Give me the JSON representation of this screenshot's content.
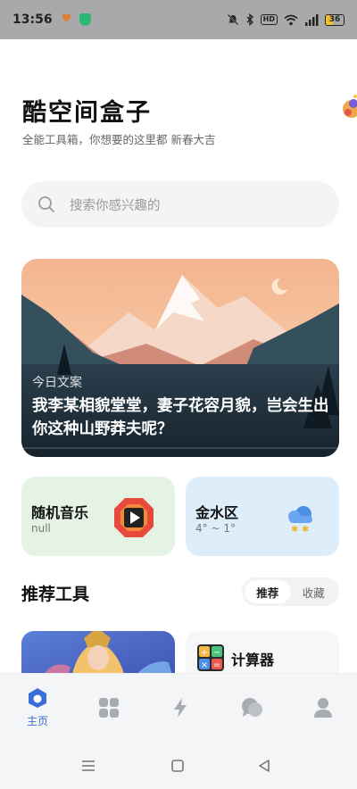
{
  "status_bar": {
    "time": "13:56",
    "battery": "36"
  },
  "header": {
    "title": "酷空间盒子",
    "subtitle": "全能工具箱，你想要的这里都  新春大吉"
  },
  "search": {
    "placeholder": "搜索你感兴趣的"
  },
  "banner": {
    "label": "今日文案",
    "quote": "我李某相貌堂堂，妻子花容月貌，岂会生出你这种山野莽夫呢？"
  },
  "cards": {
    "music": {
      "title": "随机音乐",
      "subtitle": "null"
    },
    "weather": {
      "title": "金水区",
      "subtitle": "4° ~ 1°"
    }
  },
  "tools": {
    "section_title": "推荐工具",
    "tabs": [
      {
        "label": "推荐"
      },
      {
        "label": "收藏"
      }
    ],
    "active_tab": "推荐",
    "items": [
      {
        "label": "计算器"
      }
    ]
  },
  "bottom_nav": {
    "items": [
      {
        "label": "主页",
        "icon": "home-icon"
      },
      {
        "icon": "grid-icon"
      },
      {
        "icon": "lightning-icon"
      },
      {
        "icon": "chat-icon"
      },
      {
        "icon": "user-icon"
      }
    ],
    "active_color": "#3a6fd8",
    "inactive_color": "#a8abb2"
  },
  "colors": {
    "status_bar_bg": "#a9a9ab",
    "music_card_bg": "#e5f3e4",
    "weather_card_bg": "#ddeefa",
    "accent": "#3a6fd8"
  }
}
